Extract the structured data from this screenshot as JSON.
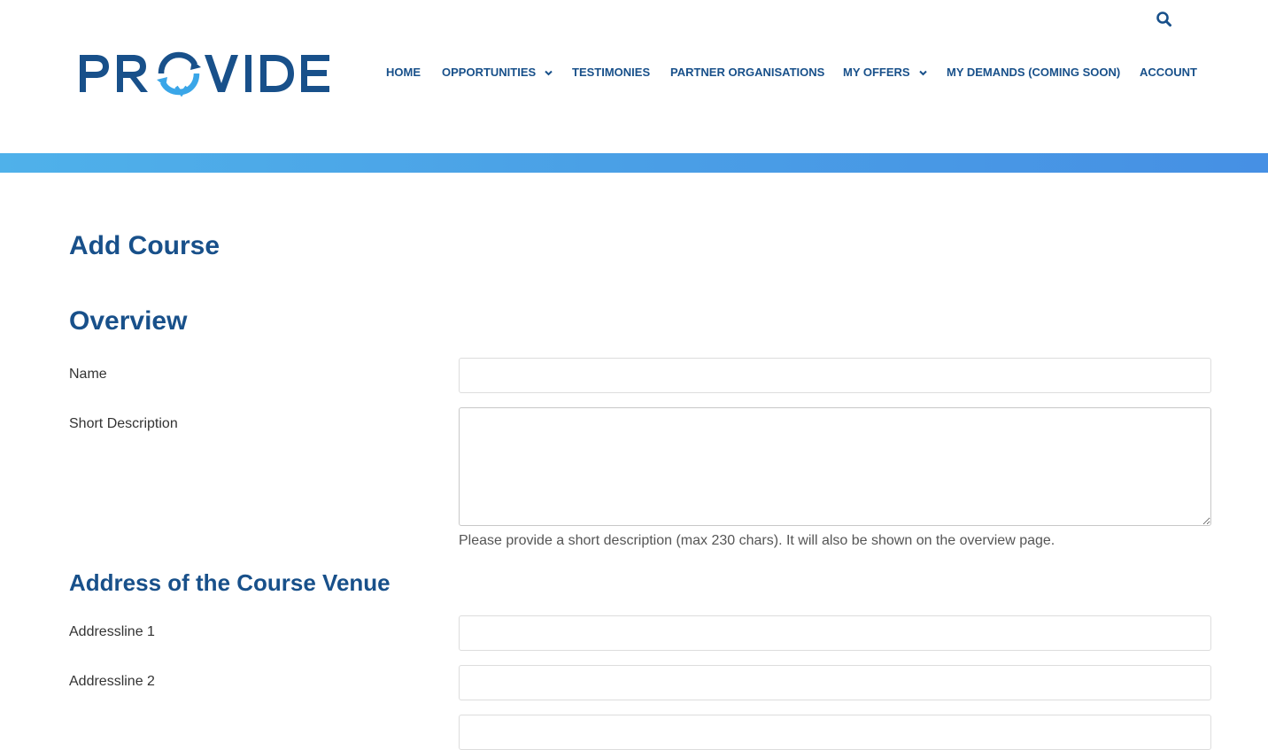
{
  "brand": {
    "logo_text": "PROVIDE",
    "colors": {
      "primary": "#18508a",
      "accent": "#3aa6e8",
      "band_start": "#4fb1ea",
      "band_end": "#4690e4"
    }
  },
  "header": {
    "search_icon": "search-icon",
    "nav": {
      "home": "HOME",
      "opportunities": "OPPORTUNITIES",
      "testimonies": "TESTIMONIES",
      "partner_organisations": "PARTNER ORGANISATIONS",
      "my_offers": "MY OFFERS",
      "my_demands": "MY DEMANDS (COMING SOON)",
      "account": "ACCOUNT"
    }
  },
  "page": {
    "title": "Add Course"
  },
  "overview": {
    "heading": "Overview",
    "name_label": "Name",
    "name_value": "",
    "short_description_label": "Short Description",
    "short_description_value": "",
    "short_description_help": "Please provide a short description (max 230 chars). It will also be shown on the overview page."
  },
  "address": {
    "heading": "Address of the Course Venue",
    "line1_label": "Addressline 1",
    "line1_value": "",
    "line2_label": "Addressline 2",
    "line2_value": ""
  }
}
